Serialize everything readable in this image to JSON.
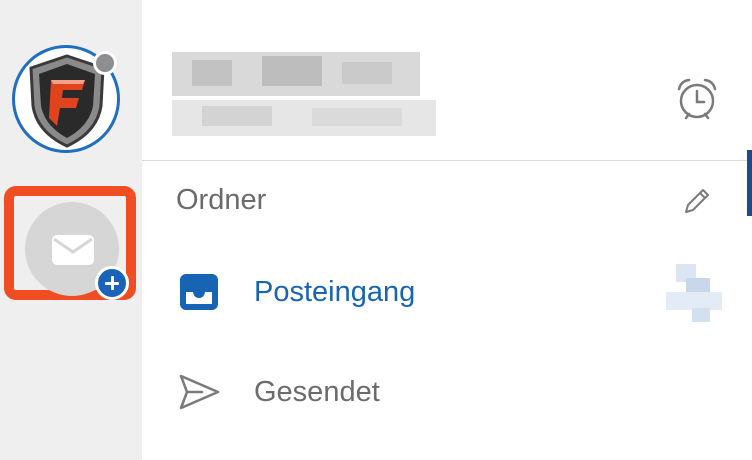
{
  "rail": {
    "accounts": [
      {
        "icon": "shield-logo",
        "status": "gray"
      }
    ],
    "add_account": {
      "icon": "mail-icon",
      "badge_icon": "plus-icon",
      "highlight_color": "#f04e22"
    }
  },
  "header": {
    "account_name": "",
    "account_email": "",
    "alarm_icon": "alarm-clock-icon"
  },
  "folders_section": {
    "title": "Ordner",
    "edit_icon": "pencil-icon"
  },
  "folders": [
    {
      "label": "Posteingang",
      "icon": "inbox-icon",
      "selected": true,
      "color": "#1764b4"
    },
    {
      "label": "Gesendet",
      "icon": "send-icon",
      "selected": false,
      "color": "#6b6b6b"
    }
  ]
}
